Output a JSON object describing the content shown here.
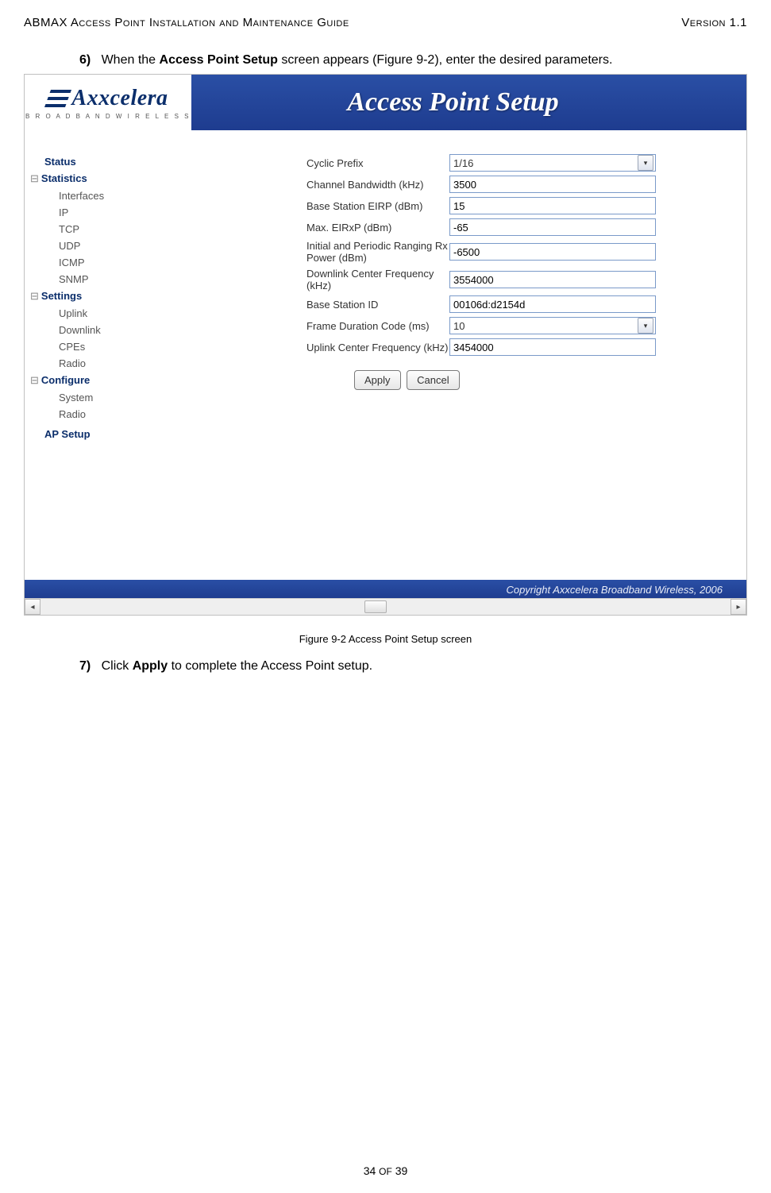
{
  "header": {
    "left": "ABMAX Access Point Installation and Maintenance Guide",
    "right": "Version 1.1"
  },
  "step6": {
    "num": "6)",
    "pre": "When the ",
    "bold": "Access Point Setup",
    "post": " screen appears (Figure 9-2), enter the desired parameters."
  },
  "logo": {
    "brand": "Axxcelera",
    "sub": "B R O A D B A N D   W I R E L E S S"
  },
  "title": "Access Point Setup",
  "nav": {
    "status": "Status",
    "statistics": "Statistics",
    "stat_items": [
      "Interfaces",
      "IP",
      "TCP",
      "UDP",
      "ICMP",
      "SNMP"
    ],
    "settings": "Settings",
    "set_items": [
      "Uplink",
      "Downlink",
      "CPEs",
      "Radio"
    ],
    "configure": "Configure",
    "conf_items": [
      "System",
      "Radio"
    ],
    "ap_setup": "AP Setup"
  },
  "form": [
    {
      "label": "Cyclic Prefix",
      "value": "1/16",
      "type": "select"
    },
    {
      "label": "Channel Bandwidth (kHz)",
      "value": "3500",
      "type": "text"
    },
    {
      "label": "Base Station EIRP (dBm)",
      "value": "15",
      "type": "text"
    },
    {
      "label": "Max. EIRxP (dBm)",
      "value": "-65",
      "type": "text"
    },
    {
      "label": "Initial and Periodic Ranging Rx Power (dBm)",
      "value": "-6500",
      "type": "text"
    },
    {
      "label": "Downlink Center Frequency (kHz)",
      "value": "3554000",
      "type": "text"
    },
    {
      "label": "Base Station ID",
      "value": "00106d:d2154d",
      "type": "text"
    },
    {
      "label": "Frame Duration Code (ms)",
      "value": "10",
      "type": "select"
    },
    {
      "label": "Uplink Center Frequency (kHz)",
      "value": "3454000",
      "type": "text"
    }
  ],
  "buttons": {
    "apply": "Apply",
    "cancel": "Cancel"
  },
  "copyright": "Copyright Axxcelera Broadband Wireless, 2006",
  "figcaption": "Figure 9-2 Access Point Setup screen",
  "step7": {
    "num": "7)",
    "pre": "Click ",
    "bold": "Apply",
    "post": " to complete the Access Point setup."
  },
  "footer": "34 OF 39"
}
